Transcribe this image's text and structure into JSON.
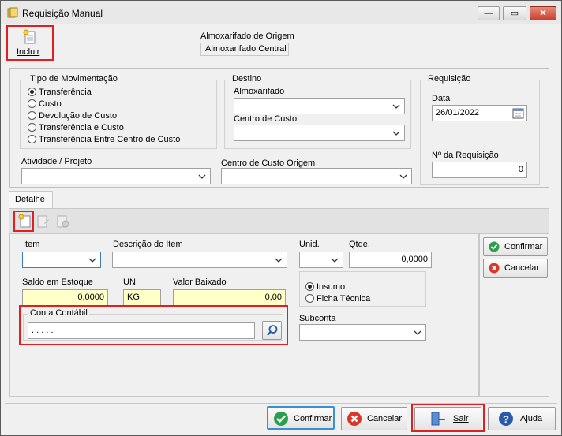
{
  "window": {
    "title": "Requisição Manual",
    "close_glyph": "✕",
    "minimize_glyph": "—",
    "maximize_glyph": "▭"
  },
  "header": {
    "incluir_label": "Incluir",
    "almox_origem_label": "Almoxarifado de Origem",
    "almox_origem_value": "Almoxarifado Central"
  },
  "tipo": {
    "title": "Tipo de Movimentação",
    "options": [
      "Transferência",
      "Custo",
      "Devolução de Custo",
      "Transferência e Custo",
      "Transferência Entre Centro de Custo"
    ],
    "selected": 0
  },
  "destino": {
    "title": "Destino",
    "almox_label": "Almoxarifado",
    "centro_label": "Centro de Custo"
  },
  "requisicao": {
    "title": "Requisição",
    "data_label": "Data",
    "data_value": "26/01/2022",
    "numero_label": "Nº  da Requisição",
    "numero_value": "0"
  },
  "atividade_label": "Atividade / Projeto",
  "centro_origem_label": "Centro de Custo Origem",
  "detalhe": {
    "tab_label": "Detalhe",
    "item_label": "Item",
    "descricao_label": "Descrição do Item",
    "unid_label": "Unid.",
    "qtde_label": "Qtde.",
    "qtde_value": "0,0000",
    "saldo_label": "Saldo em Estoque",
    "saldo_value": "0,0000",
    "un_label": "UN",
    "un_value": "KG",
    "valor_label": "Valor Baixado",
    "valor_value": "0,00",
    "insumo_label": "Insumo",
    "ficha_label": "Ficha Técnica",
    "conta_label": "Conta Contábil",
    "conta_value": ". . . . .",
    "subconta_label": "Subconta",
    "confirmar_label": "Confirmar",
    "cancelar_label": "Cancelar"
  },
  "footer": {
    "confirmar_label": "Confirmar",
    "cancelar_label": "Cancelar",
    "sair_label": "Sair",
    "ajuda_label": "Ajuda"
  },
  "colors": {
    "highlight": "#e02020",
    "confirm": "#2e9e4a",
    "cancel": "#d9352a",
    "help": "#2a5aa8"
  },
  "icons": [
    "app-icon",
    "new-document-icon",
    "calendar-icon",
    "search-icon",
    "check-icon",
    "cancel-icon",
    "exit-door-icon",
    "help-icon"
  ]
}
